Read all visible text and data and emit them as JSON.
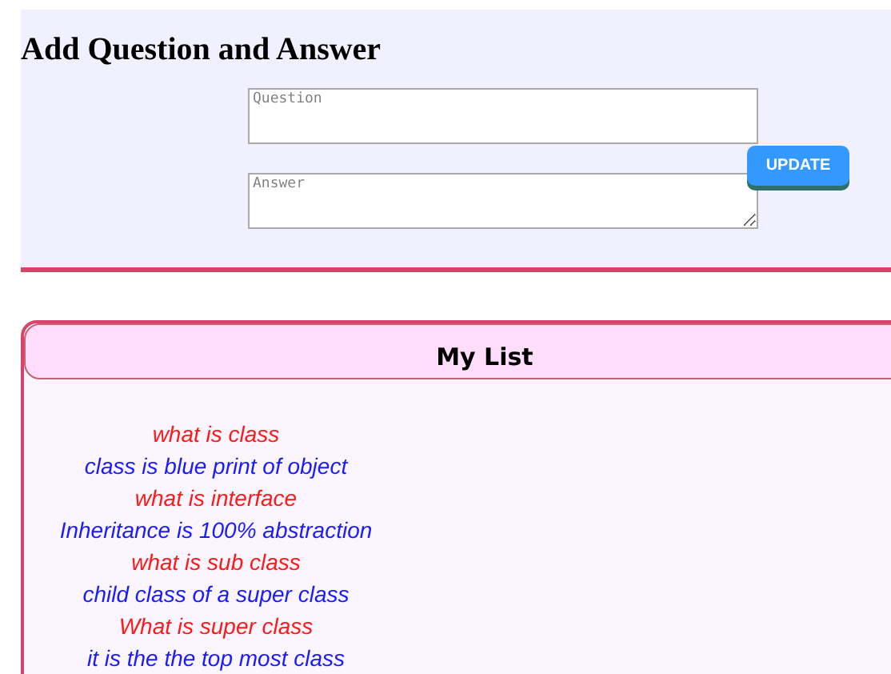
{
  "form": {
    "title": "Add Question and Answer",
    "question": {
      "placeholder": "Question"
    },
    "answer": {
      "placeholder": "Answer"
    },
    "button": "UPDATE"
  },
  "list": {
    "title": "My List",
    "items": [
      {
        "kind": "question",
        "text": "what is class"
      },
      {
        "kind": "answer",
        "text": "class is blue print of object"
      },
      {
        "kind": "question",
        "text": "what is interface"
      },
      {
        "kind": "answer",
        "text": "Inheritance is 100% abstraction"
      },
      {
        "kind": "question",
        "text": "what is sub class"
      },
      {
        "kind": "answer",
        "text": "child class of a super class"
      },
      {
        "kind": "question",
        "text": "What is super class"
      },
      {
        "kind": "answer",
        "text": "it is the the top most class"
      }
    ]
  }
}
